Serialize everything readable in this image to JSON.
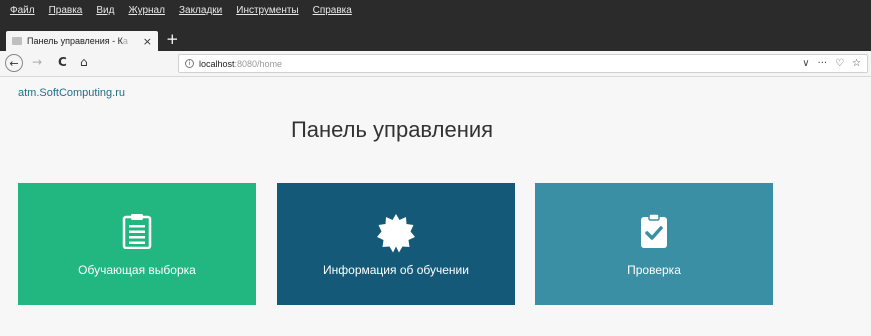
{
  "browser": {
    "menu": [
      "Файл",
      "Правка",
      "Вид",
      "Журнал",
      "Закладки",
      "Инструменты",
      "Справка"
    ],
    "tab": {
      "title": "Панель управления - К",
      "title_faded": "а",
      "close": "×",
      "new_tab": "+"
    },
    "nav": {
      "back": "←",
      "forward": "→",
      "reload": "C",
      "home": "⌂",
      "url_host": "localhost",
      "url_rest": ":8080/home",
      "actions": [
        "∨",
        "···",
        "♡",
        "☆"
      ]
    }
  },
  "page": {
    "site_link": "atm.SoftComputing.ru",
    "title": "Панель управления",
    "cards": [
      {
        "label": "Обучающая выборка",
        "icon": "clipboard-list-icon",
        "color": "#22b780"
      },
      {
        "label": "Информация об обучении",
        "icon": "certificate-icon",
        "color": "#145a78"
      },
      {
        "label": "Проверка",
        "icon": "clipboard-check-icon",
        "color": "#3b8fa4"
      }
    ]
  }
}
